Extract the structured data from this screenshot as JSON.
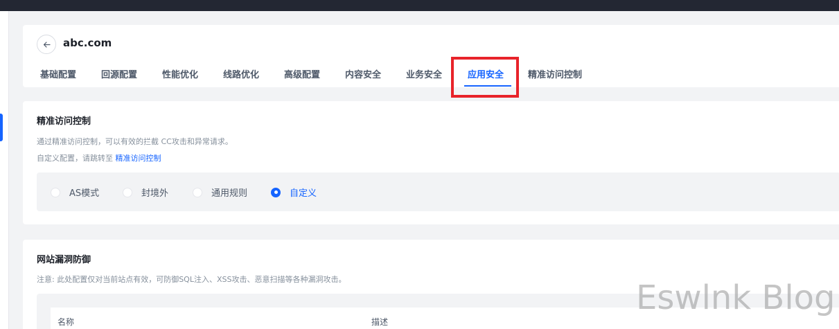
{
  "header": {
    "domain": "abc.com",
    "back_icon": "arrow-left-icon",
    "tabs": [
      {
        "label": "基础配置",
        "active": false
      },
      {
        "label": "回源配置",
        "active": false
      },
      {
        "label": "性能优化",
        "active": false
      },
      {
        "label": "线路优化",
        "active": false
      },
      {
        "label": "高级配置",
        "active": false
      },
      {
        "label": "内容安全",
        "active": false
      },
      {
        "label": "业务安全",
        "active": false
      },
      {
        "label": "应用安全",
        "active": true
      },
      {
        "label": "精准访问控制",
        "active": false
      }
    ]
  },
  "access_control": {
    "title": "精准访问控制",
    "desc1": "通过精准访问控制，可以有效的拦截 CC攻击和异常请求。",
    "desc2_prefix": "自定义配置，请跳转至 ",
    "desc2_link": "精准访问控制",
    "mode_options": [
      {
        "label": "AS模式",
        "checked": false
      },
      {
        "label": "封境外",
        "checked": false
      },
      {
        "label": "通用规则",
        "checked": false
      },
      {
        "label": "自定义",
        "checked": true
      }
    ]
  },
  "vuln_protection": {
    "title": "网站漏洞防御",
    "desc": "注意: 此处配置仅对当前站点有效，可防御SQL注入、XSS攻击、恶意扫描等各种漏洞攻击。",
    "columns": [
      "名称",
      "描述"
    ]
  },
  "watermark": "Eswlnk Blog",
  "colors": {
    "accent": "#1664ff",
    "highlight": "#e8232a",
    "topbar": "#232733"
  }
}
